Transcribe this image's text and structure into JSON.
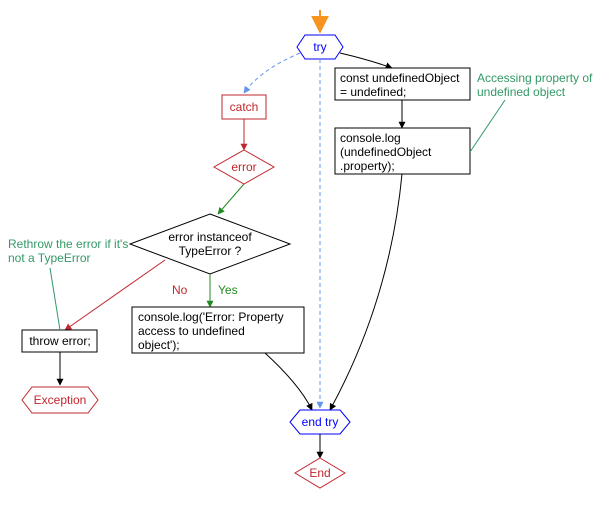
{
  "chart_data": {
    "type": "flowchart",
    "nodes": [
      {
        "id": "start_arrow",
        "kind": "entry-arrow"
      },
      {
        "id": "try",
        "kind": "hexagon",
        "label": "try",
        "stroke": "#0000ff"
      },
      {
        "id": "catch",
        "kind": "rect",
        "label": "catch",
        "stroke": "#b22222"
      },
      {
        "id": "error",
        "kind": "diamond",
        "label": "error",
        "stroke": "#b22222"
      },
      {
        "id": "instanceof",
        "kind": "diamond",
        "label": "error instanceof TypeError ?",
        "stroke": "#000000"
      },
      {
        "id": "throw",
        "kind": "rect",
        "label": "throw error;",
        "stroke": "#000000"
      },
      {
        "id": "exception",
        "kind": "hexagon",
        "label": "Exception",
        "stroke": "#b22222"
      },
      {
        "id": "log_access",
        "kind": "rect",
        "label": "console.log('Error: Property access to undefined object');",
        "stroke": "#000000"
      },
      {
        "id": "const_undef",
        "kind": "rect",
        "label": "const undefinedObject = undefined;",
        "stroke": "#000000"
      },
      {
        "id": "log_prop",
        "kind": "rect",
        "label": "console.log (undefinedObject .property);",
        "stroke": "#000000"
      },
      {
        "id": "end_try",
        "kind": "hexagon",
        "label": "end try",
        "stroke": "#0000ff"
      },
      {
        "id": "end",
        "kind": "diamond",
        "label": "End",
        "stroke": "#b22222"
      }
    ],
    "edges": [
      {
        "from": "try",
        "to": "catch",
        "style": "dashed",
        "color": "#6495ed"
      },
      {
        "from": "try",
        "to": "const_undef",
        "color": "#000000"
      },
      {
        "from": "try",
        "to": "end_try",
        "style": "dashed",
        "color": "#6495ed"
      },
      {
        "from": "catch",
        "to": "error",
        "color": "#b22222"
      },
      {
        "from": "error",
        "to": "instanceof",
        "color": "#228b22"
      },
      {
        "from": "instanceof",
        "to": "throw",
        "label": "No",
        "color": "#b22222"
      },
      {
        "from": "instanceof",
        "to": "log_access",
        "label": "Yes",
        "color": "#228b22"
      },
      {
        "from": "throw",
        "to": "exception",
        "color": "#000000"
      },
      {
        "from": "log_access",
        "to": "end_try",
        "color": "#000000"
      },
      {
        "from": "const_undef",
        "to": "log_prop",
        "color": "#000000"
      },
      {
        "from": "log_prop",
        "to": "end_try",
        "color": "#000000"
      },
      {
        "from": "end_try",
        "to": "end",
        "color": "#000000"
      }
    ],
    "annotations": [
      {
        "text": "Accessing property of undefined object",
        "target": "log_prop",
        "color": "#339966"
      },
      {
        "text": "Rethrow the error if it's not a TypeError",
        "target": "throw",
        "color": "#339966"
      }
    ]
  },
  "labels": {
    "try": "try",
    "catch": "catch",
    "error": "error",
    "instanceof_l1": "error instanceof",
    "instanceof_l2": "TypeError ?",
    "throw": "throw error;",
    "exception": "Exception",
    "log_access_l1": "console.log('Error: Property",
    "log_access_l2": "access to undefined",
    "log_access_l3": "object');",
    "const_undef_l1": "const undefinedObject",
    "const_undef_l2": "= undefined;",
    "log_prop_l1": "console.log",
    "log_prop_l2": "(undefinedObject",
    "log_prop_l3": ".property);",
    "end_try": "end try",
    "end": "End",
    "edge_no": "No",
    "edge_yes": "Yes",
    "anno_access_l1": "Accessing property of",
    "anno_access_l2": "undefined object",
    "anno_rethrow_l1": "Rethrow the error if it's",
    "anno_rethrow_l2": "not a TypeError"
  },
  "colors": {
    "blue": "#0000ff",
    "lightblue": "#6495ed",
    "red": "#c1272d",
    "green_edge": "#228b22",
    "green_text": "#339966",
    "orange": "#f7931e",
    "black": "#000000"
  }
}
